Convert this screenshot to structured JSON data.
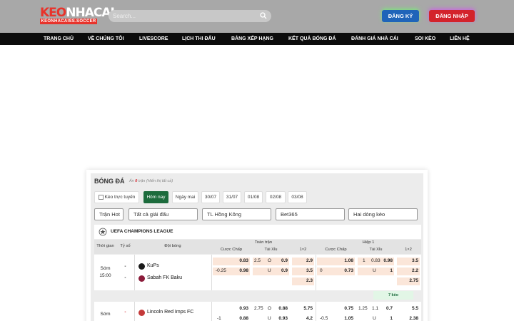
{
  "brand": {
    "logo_main_a": "KEO",
    "logo_main_b": "NHACAI",
    "logo_sub": "KEONHACAISS.SOCCER"
  },
  "search": {
    "placeholder": "Search..."
  },
  "auth": {
    "register": "ĐĂNG KÝ",
    "login": "ĐĂNG NHẬP"
  },
  "nav": [
    "TRANG CHỦ",
    "VỀ CHÚNG TÔI",
    "LIVESCORE",
    "LỊCH THI ĐẤU",
    "BẢNG XẾP HẠNG",
    "KẾT QUẢ BÓNG ĐÁ",
    "ĐÁNH GIÁ NHÀ CÁI",
    "SOI KÈO",
    "LIÊN HỆ"
  ],
  "section": {
    "title": "BÓNG ĐÁ",
    "hidden_prefix": "Ẩn ",
    "hidden_count": "0",
    "hidden_suffix": " trận (Hiển thị tất cả)"
  },
  "chips": [
    "Kèo trực tuyến",
    "Hôm nay",
    "Ngày mai",
    "30/07",
    "31/07",
    "01/08",
    "02/08",
    "03/08"
  ],
  "filters": [
    "Trận Hot",
    "Tất cả giải đấu",
    "TL Hồng Kông",
    "Bet365",
    "Hai dòng kèo"
  ],
  "league": {
    "name": "UEFA CHAMPIONS LEAGUE"
  },
  "table_head": {
    "time": "Thời gian",
    "score": "Tỷ số",
    "teams": "Đội bóng",
    "full": "Toàn trận",
    "half": "Hiệp 1",
    "handicap": "Cược Chấp",
    "ou": "Tài Xỉu",
    "x12": "1×2"
  },
  "matches": [
    {
      "status": "Sớm",
      "time": "15:00",
      "score_home": "-",
      "score_away": "-",
      "home": "KuPs",
      "away": "Sabah FK Baku",
      "ft_hdp_line_away": "-0.25",
      "ft_hdp_home": "0.83",
      "ft_hdp_away": "0.98",
      "ft_ou_line": "2.5",
      "ft_ou_o_label": "O",
      "ft_ou_u_label": "U",
      "ft_ou_over": "0.9",
      "ft_ou_under": "0.9",
      "ft_1": "2.9",
      "ft_2": "3.5",
      "ft_x": "2.3",
      "h1_hdp_line_away": "0",
      "h1_hdp_home": "1.08",
      "h1_hdp_away": "0.73",
      "h1_ou_line": "1",
      "h1_ou_line2": "0.83",
      "h1_ou_over": "0.98",
      "h1_ou_under": "1",
      "h1_1": "3.5",
      "h1_2": "2.2",
      "h1_x": "2.75",
      "more": "7 kèo"
    },
    {
      "status": "Sớm",
      "score_home": "-",
      "home": "Lincoln Red Imps FC",
      "ft_hdp_line_away": "-1",
      "ft_hdp_home": "0.93",
      "ft_hdp_away": "0.88",
      "ft_ou_line": "2.75",
      "ft_ou_o_label": "O",
      "ft_ou_u_label": "U",
      "ft_ou_over": "0.88",
      "ft_ou_under": "0.93",
      "ft_1": "5.75",
      "ft_2": "4.2",
      "h1_hdp_line_away": "-0.5",
      "h1_hdp_home": "0.75",
      "h1_hdp_away": "1.05",
      "h1_ou_line": "1.25",
      "h1_ou_line2": "1.1",
      "h1_ou_over": "0.7",
      "h1_ou_under": "1",
      "h1_1": "5.5",
      "h1_2": "2.38"
    }
  ],
  "colors": {
    "header_bg": "#a8a8a8",
    "nav_bg": "#0c0c0c",
    "register": "#1f64b9",
    "login": "#d3232b",
    "active_chip": "#1c6b3c",
    "odds_highlight": "#fbe6d9"
  }
}
